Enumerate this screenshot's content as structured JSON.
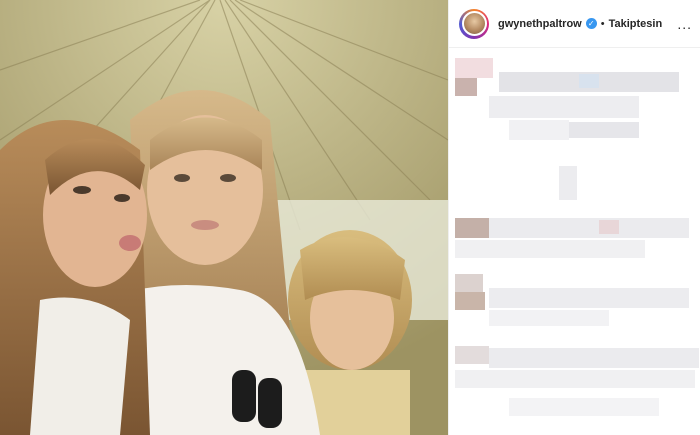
{
  "post": {
    "username": "gwynethpaltrow",
    "separator": "•",
    "follow_label": "Takiptesin",
    "more_label": "...",
    "verified_symbol": "✓",
    "verified_color": "#3897f0",
    "photo_icon": "family-selfie-photo",
    "comments_state": "pixelated"
  }
}
